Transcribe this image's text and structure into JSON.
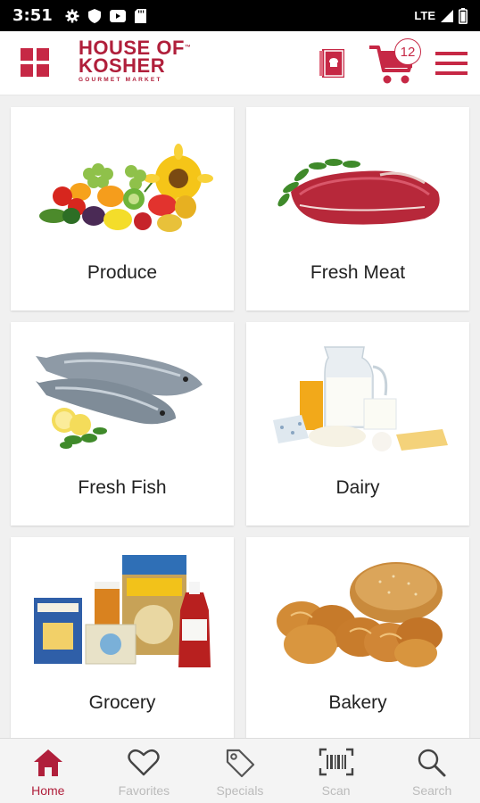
{
  "status": {
    "time": "3:51",
    "network": "LTE"
  },
  "header": {
    "logo_line1": "HOUSE OF",
    "logo_tm": "™",
    "logo_line2": "KOSHER",
    "logo_line3": "GOURMET MARKET",
    "cart_count": "12"
  },
  "categories": [
    {
      "label": "Produce"
    },
    {
      "label": "Fresh Meat"
    },
    {
      "label": "Fresh Fish"
    },
    {
      "label": "Dairy"
    },
    {
      "label": "Grocery"
    },
    {
      "label": "Bakery"
    }
  ],
  "nav": [
    {
      "label": "Home",
      "icon": "home-icon",
      "active": true
    },
    {
      "label": "Favorites",
      "icon": "heart-icon",
      "active": false
    },
    {
      "label": "Specials",
      "icon": "tag-icon",
      "active": false
    },
    {
      "label": "Scan",
      "icon": "barcode-icon",
      "active": false
    },
    {
      "label": "Search",
      "icon": "search-icon",
      "active": false
    }
  ],
  "colors": {
    "brand": "#b01f3b",
    "accent": "#c62845",
    "inactive": "#bbbbbb"
  }
}
